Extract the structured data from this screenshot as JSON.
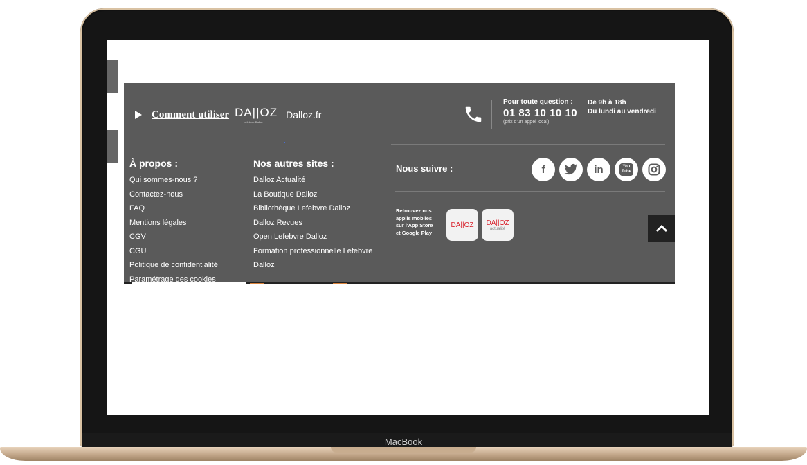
{
  "device": {
    "brand": "MacBook"
  },
  "footer": {
    "how_to_use": {
      "label": "Comment utiliser",
      "logo": "DA||OZ",
      "logo_sub": "Lefebvre Dalloz",
      "site": "Dalloz.fr"
    },
    "contact": {
      "question": "Pour toute question :",
      "phone": "01 83 10 10 10",
      "price_note": "(prix d'un appel local)"
    },
    "hours": {
      "line1": "De 9h à 18h",
      "line2": "Du lundi au vendredi"
    },
    "about": {
      "title": "À propos :",
      "links": [
        "Qui sommes-nous ?",
        "Contactez-nous",
        "FAQ",
        "Mentions légales",
        "CGV",
        "CGU",
        "Politique de confidentialité",
        "Paramétrage des cookies"
      ]
    },
    "other_sites": {
      "title": "Nos autres sites :",
      "links": [
        "Dalloz Actualité",
        "La Boutique Dalloz",
        "Bibliothèque Lefebvre Dalloz",
        "Dalloz Revues",
        "Open Lefebvre Dalloz",
        "Formation professionnelle Lefebvre",
        "Dalloz"
      ]
    },
    "follow": {
      "label": "Nous suivre :",
      "icons": [
        "facebook-icon",
        "twitter-icon",
        "linkedin-icon",
        "youtube-icon",
        "instagram-icon"
      ],
      "youtube_text": "You Tube"
    },
    "apps": {
      "text_lines": [
        "Retrouvez nos",
        "applis mobiles",
        "sur l'App Store",
        "et Google Play"
      ],
      "app1": "DA||OZ",
      "app2": "DA||OZ",
      "app2_sub": "actualité"
    },
    "colors": {
      "footer_bg": "#5a5a5a",
      "brand_red": "#d8202b"
    }
  }
}
